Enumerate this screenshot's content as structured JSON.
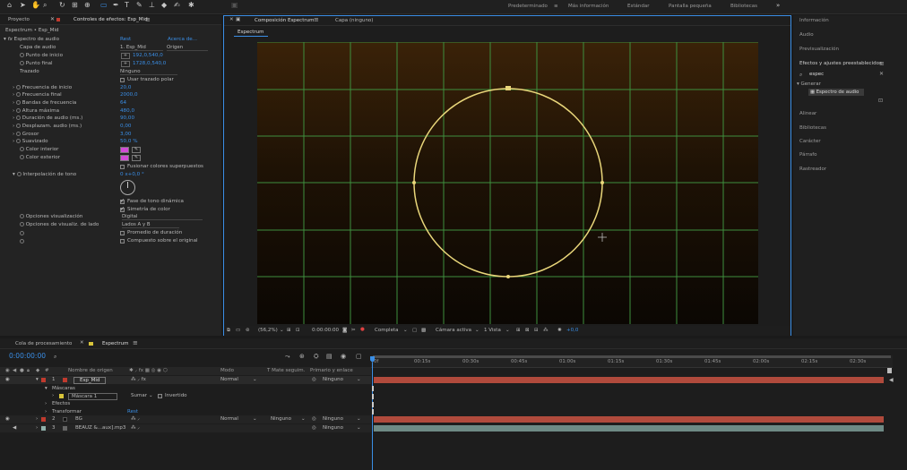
{
  "workspaces": {
    "items": [
      "Predeterminado",
      "Más información",
      "Estándar",
      "Pantalla pequeña",
      "Bibliotecas"
    ],
    "more": "»"
  },
  "left_panel": {
    "tab_project": "Proyecto",
    "tab_effects": "Controles de efectos: Esp_Mid",
    "breadcrumb": "Espectrum • Esp_Mid",
    "effect_name": "Espectro de audio",
    "reset": "Rest",
    "about": "Acerca de...",
    "audio_layer_label": "Capa de audio",
    "audio_layer_value": "1. Esp_Mid",
    "audio_layer_source": "Origen",
    "start_point_label": "Punto de inicio",
    "start_point_value": "192,0,540,0",
    "end_point_label": "Punto final",
    "end_point_value": "1728,0,540,0",
    "path_label": "Trazado",
    "path_value": "Ninguno",
    "polar_label": "Usar trazado polar",
    "start_freq_label": "Frecuencia de inicio",
    "start_freq_value": "20,0",
    "end_freq_label": "Frecuencia final",
    "end_freq_value": "2000,0",
    "bands_label": "Bandas de frecuencia",
    "bands_value": "64",
    "max_height_label": "Altura máxima",
    "max_height_value": "480,0",
    "duration_label": "Duración de audio (ms.)",
    "duration_value": "90,00",
    "offset_label": "Desplazam. audio (ms.)",
    "offset_value": "0,00",
    "thickness_label": "Grosor",
    "thickness_value": "3,00",
    "softness_label": "Suavizado",
    "softness_value": "50,0 %",
    "inner_color_label": "Color interior",
    "outer_color_label": "Color exterior",
    "merge_label": "Fusionar colores superpuestos",
    "hue_label": "Interpolación de tono",
    "hue_value": "0 x+0,0 °",
    "dynamic_phase_label": "Fase de tono dinámica",
    "color_symmetry_label": "Simetría de color",
    "display_options_label": "Opciones visualización",
    "display_options_value": "Digital",
    "side_options_label": "Opciones de visualiz. de lado",
    "side_options_value": "Lados A y B",
    "avg_duration_label": "Promedio de duración",
    "composite_label": "Compuesto sobre el original"
  },
  "colors": {
    "inner_color": "#d24cd6",
    "outer_color": "#d24cd6",
    "accent": "#3a8ee6",
    "circle": "#e9d67a",
    "grid": "#3e8f3e",
    "bar_red": "#b04a3c",
    "bar_teal": "#6e8a85"
  },
  "comp_panel": {
    "tab_comp": "Composición Espectrum",
    "tab_layer": "Capa (ninguno)",
    "subtab": "Espectrum",
    "zoom": "(56,2%)",
    "timecode": "0:00:00:00",
    "resolution": "Completa",
    "camera": "Cámara activa",
    "views": "1 Vista",
    "exposure": "+0,0"
  },
  "right_panel": {
    "info": "Información",
    "audio": "Audio",
    "preview": "Previsualización",
    "effects_presets": "Efectos y ajustes preestablecidos",
    "search_value": "espec",
    "category": "Generar",
    "result": "Espectro de audio",
    "align": "Alinear",
    "libraries": "Bibliotecas",
    "character": "Carácter",
    "paragraph": "Párrafo",
    "tracker": "Rastreador"
  },
  "timeline": {
    "tab_queue": "Cola de procesamiento",
    "tab_comp": "Espectrum",
    "timecode": "0:00:00:00",
    "col_source": "Nombre de origen",
    "col_mode": "Modo",
    "col_matte": "T Mate seguim.",
    "col_parent": "Primario y enlace",
    "ruler": [
      "0f",
      "00:15s",
      "00:30s",
      "00:45s",
      "01:00s",
      "01:15s",
      "01:30s",
      "01:45s",
      "02:00s",
      "02:15s",
      "02:30s"
    ],
    "layers": [
      {
        "num": "1",
        "name": "Esp_Mid",
        "mode": "Normal",
        "parent": "Ninguno"
      },
      {
        "num": "2",
        "name": "BG",
        "mode": "Normal",
        "matte": "Ninguno",
        "parent": "Ninguno"
      },
      {
        "num": "3",
        "name": "BEAUZ &...aux].mp3",
        "parent": "Ninguno"
      }
    ],
    "masks_label": "Máscaras",
    "mask_name": "Máscara 1",
    "mask_mode": "Sumar",
    "mask_inverted": "Invertido",
    "effects_label": "Efectos",
    "transform_label": "Transformar",
    "transform_reset": "Rest"
  }
}
